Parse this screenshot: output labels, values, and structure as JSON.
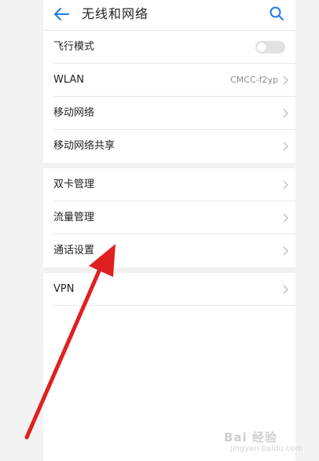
{
  "header": {
    "title": "无线和网络",
    "back_icon": "arrow-left-icon",
    "search_icon": "search-icon"
  },
  "groups": [
    {
      "items": [
        {
          "label": "飞行模式",
          "control": "toggle",
          "toggle_on": false
        },
        {
          "label": "WLAN",
          "value": "CMCC-f2yp"
        },
        {
          "label": "移动网络"
        },
        {
          "label": "移动网络共享"
        }
      ]
    },
    {
      "items": [
        {
          "label": "双卡管理"
        },
        {
          "label": "流量管理"
        },
        {
          "label": "通话设置"
        }
      ]
    },
    {
      "items": [
        {
          "label": "VPN"
        }
      ]
    }
  ],
  "watermark": {
    "text": "Bai 经验",
    "sub": "jingyan.baidu.com"
  },
  "colors": {
    "accent": "#1e7be6",
    "annotation_arrow": "#e02020"
  }
}
